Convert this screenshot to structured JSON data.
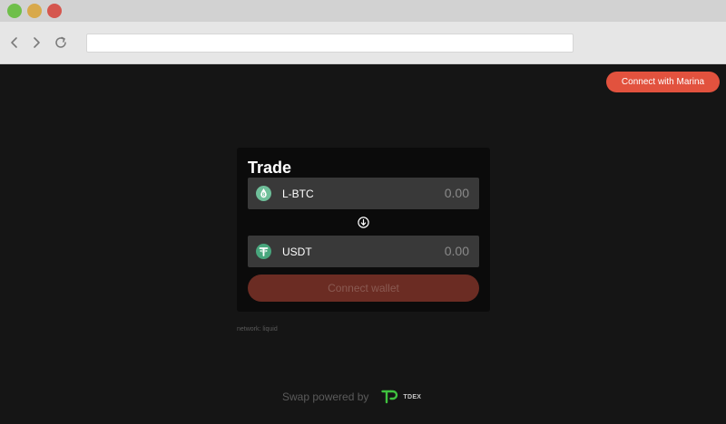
{
  "browser": {
    "url": ""
  },
  "header": {
    "connect_marina_label": "Connect with Marina"
  },
  "trade": {
    "title": "Trade",
    "from_asset": {
      "label": "L-BTC",
      "amount": "0.00",
      "icon": "lbtc-icon",
      "color": "#6fbf9a"
    },
    "to_asset": {
      "label": "USDT",
      "amount": "0.00",
      "icon": "tether-icon",
      "color": "#48a67d"
    },
    "connect_wallet_label": "Connect wallet"
  },
  "network_label": "network: liquid",
  "footer": {
    "powered_by": "Swap powered by",
    "brand": "TDEX"
  },
  "colors": {
    "accent": "#e2523e",
    "background": "#151515",
    "brand_green": "#3fc23f"
  }
}
